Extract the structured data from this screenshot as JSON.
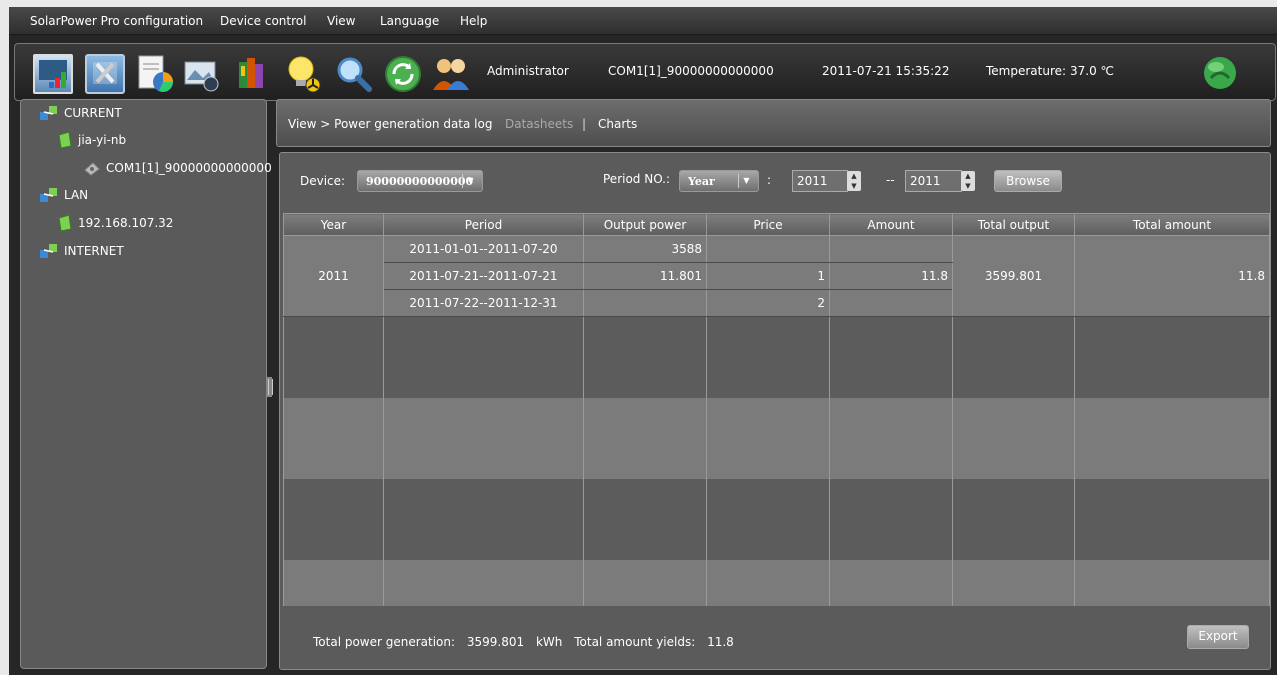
{
  "menu": [
    "SolarPower Pro configuration",
    "Device control",
    "View",
    "Language",
    "Help"
  ],
  "toolbar": {
    "user": "Administrator",
    "device": "COM1[1]_90000000000000",
    "datetime": "2011-07-21 15:35:22",
    "temperature_label": "Temperature:",
    "temperature_value": "37.0 ℃"
  },
  "tree": {
    "current": "CURRENT",
    "host": "jia-yi-nb",
    "com": "COM1[1]_90000000000000",
    "lan": "LAN",
    "ip": "192.168.107.32",
    "internet": "INTERNET"
  },
  "breadcrumb": {
    "path": "View > Power generation data log",
    "datasheets": "Datasheets",
    "sep": "|",
    "charts": "Charts"
  },
  "filter": {
    "device_label": "Device:",
    "device_value": "90000000000000",
    "period_label": "Period NO.:",
    "period_value": "Year",
    "colon": ":",
    "from_year": "2011",
    "dash": "--",
    "to_year": "2011",
    "browse": "Browse"
  },
  "table": {
    "headers": [
      "Year",
      "Period",
      "Output power",
      "Price",
      "Amount",
      "Total output",
      "Total amount"
    ],
    "year": "2011",
    "total_output": "3599.801",
    "total_amount": "11.8",
    "rows": [
      {
        "period": "2011-01-01--2011-07-20",
        "output": "3588",
        "price": "",
        "amount": ""
      },
      {
        "period": "2011-07-21--2011-07-21",
        "output": "11.801",
        "price": "1",
        "amount": "11.8"
      },
      {
        "period": "2011-07-22--2011-12-31",
        "output": "",
        "price": "2",
        "amount": ""
      }
    ]
  },
  "status": {
    "gen_label": "Total power generation:",
    "gen_value": "3599.801",
    "gen_unit": "kWh",
    "yield_label": "Total amount yields:",
    "yield_value": "11.8",
    "export": "Export"
  }
}
